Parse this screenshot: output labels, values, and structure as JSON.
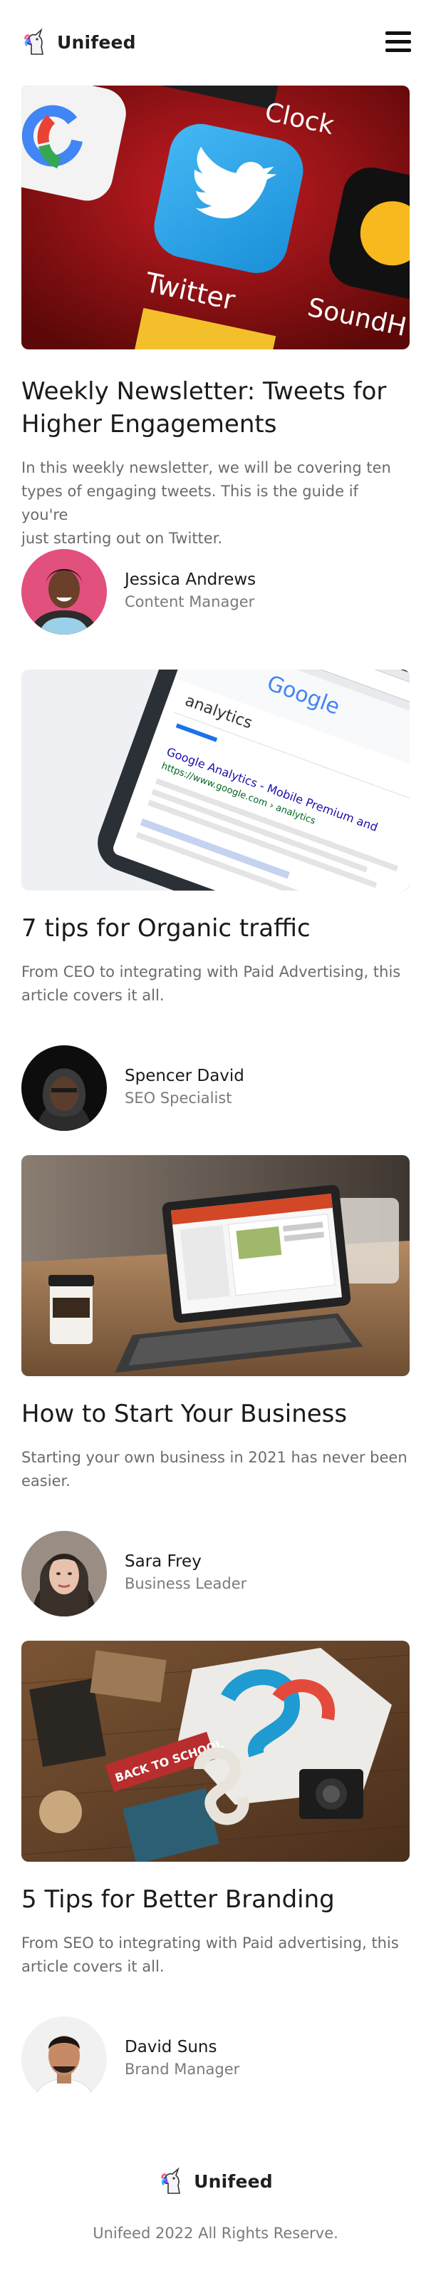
{
  "header": {
    "brand": "Unifeed",
    "menu_icon": "hamburger-menu-icon"
  },
  "posts": [
    {
      "image_label": "Twitter app icon",
      "title_lines": [
        "Weekly Newsletter: Tweets for",
        "Higher Engagements"
      ],
      "excerpt_lines": [
        "In this weekly newsletter, we will be covering ten",
        "types of engaging tweets. This is the guide if you're",
        "just starting out on Twitter."
      ],
      "author": "Jessica Andrews",
      "role": "Content Manager"
    },
    {
      "image_label": "Google search results on phone",
      "title_lines": [
        "7 tips for Organic traffic"
      ],
      "excerpt_lines": [
        "From CEO to integrating with Paid Advertising, this",
        "article covers it all."
      ],
      "author": "Spencer David",
      "role": "SEO Specialist"
    },
    {
      "image_label": "Laptop on wooden desk",
      "title_lines": [
        "How to Start Your Business"
      ],
      "excerpt_lines": [
        "Starting your own business in 2021 has never been",
        "easier."
      ],
      "author": "Sara Frey",
      "role": "Business Leader"
    },
    {
      "image_label": "Branding items on table",
      "title_lines": [
        "5 Tips for Better Branding"
      ],
      "excerpt_lines": [
        "From SEO to integrating with Paid advertising, this",
        "article covers it all."
      ],
      "author": "David Suns",
      "role": "Brand Manager"
    }
  ],
  "image_text": {
    "clock": "Clock",
    "twitter": "Twitter",
    "sound": "SoundH",
    "google": "Google",
    "analytics": "analytics",
    "result_title": "Google Analytics - Mobile Premium and",
    "result_url": "https://www.google.com › analytics",
    "back_to_school": "BACK TO SCHOOL"
  },
  "footer": {
    "brand": "Unifeed",
    "copyright": "Unifeed 2022 All Rights Reserve."
  },
  "colors": {
    "text_dark": "#1a1a1a",
    "text_muted": "#6b6b6b",
    "twitter_blue": "#1da1f2"
  }
}
